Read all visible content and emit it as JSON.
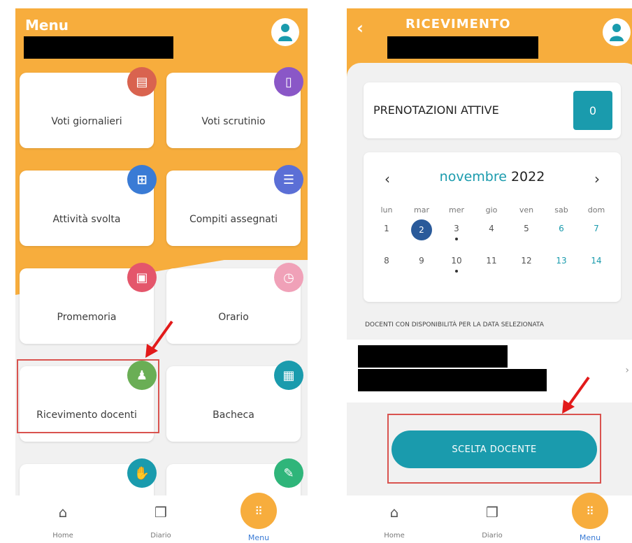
{
  "left": {
    "title": "Menu",
    "tiles": [
      {
        "label": "Voti giornalieri",
        "icon": "journal-icon",
        "color": "#d9634f"
      },
      {
        "label": "Voti scrutinio",
        "icon": "document-icon",
        "color": "#8a57c7"
      },
      {
        "label": "Attività svolta",
        "icon": "activity-icon",
        "color": "#3a7bd5"
      },
      {
        "label": "Compiti assegnati",
        "icon": "homework-icon",
        "color": "#5b6fd6"
      },
      {
        "label": "Promemoria",
        "icon": "calendar-icon",
        "color": "#e4566b"
      },
      {
        "label": "Orario",
        "icon": "clock-icon",
        "color": "#f0a1b8"
      },
      {
        "label": "Ricevimento docenti",
        "icon": "meeting-icon",
        "color": "#6aae55"
      },
      {
        "label": "Bacheca",
        "icon": "board-icon",
        "color": "#1a9bad"
      },
      {
        "label": "",
        "icon": "hand-icon",
        "color": "#1a9bad"
      },
      {
        "label": "",
        "icon": "doc-edit-icon",
        "color": "#2fb57a"
      }
    ],
    "nav": {
      "home": "Home",
      "diario": "Diario",
      "menu": "Menu"
    }
  },
  "right": {
    "title": "RICEVIMENTO",
    "prenotazioni_label": "PRENOTAZIONI ATTIVE",
    "prenotazioni_count": "0",
    "calendar": {
      "month": "novembre",
      "year": "2022",
      "prev": "‹",
      "next": "›",
      "weekdays": [
        "lun",
        "mar",
        "mer",
        "gio",
        "ven",
        "sab",
        "dom"
      ],
      "weeks": [
        [
          "1",
          "2",
          "3",
          "4",
          "5",
          "6",
          "7"
        ],
        [
          "8",
          "9",
          "10",
          "11",
          "12",
          "13",
          "14"
        ]
      ],
      "selected": "2"
    },
    "docenti_header": "DOCENTI CON DISPONIBILITÀ PER LA DATA SELEZIONATA",
    "doc_chevron": "›",
    "cta": "SCELTA DOCENTE",
    "nav": {
      "home": "Home",
      "diario": "Diario",
      "menu": "Menu"
    }
  },
  "colors": {
    "accent": "#f7ad3d",
    "teal": "#1a9bad",
    "highlight": "#d9534f"
  }
}
